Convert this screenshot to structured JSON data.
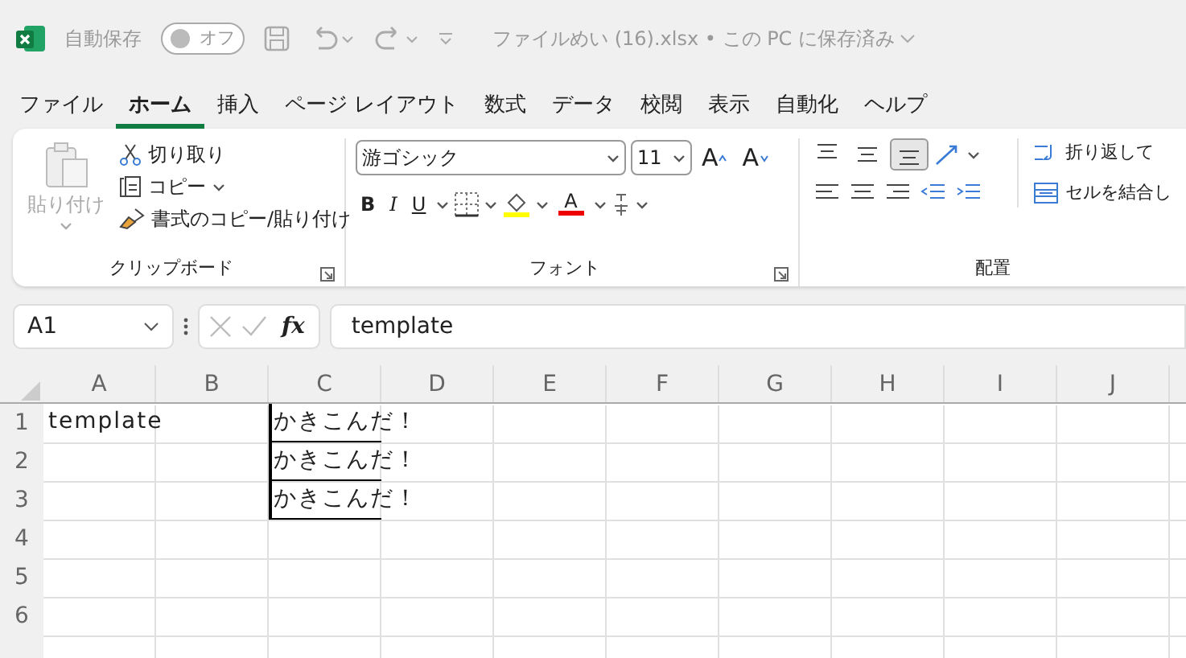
{
  "title_bar": {
    "autosave_label": "自動保存",
    "autosave_toggle": {
      "label": "オフ",
      "on": false
    },
    "file_title": "ファイルめい (16).xlsx • この PC に保存済み"
  },
  "tabs": [
    {
      "label": "ファイル",
      "selected": false
    },
    {
      "label": "ホーム",
      "selected": true
    },
    {
      "label": "挿入",
      "selected": false
    },
    {
      "label": "ページ レイアウト",
      "selected": false
    },
    {
      "label": "数式",
      "selected": false
    },
    {
      "label": "データ",
      "selected": false
    },
    {
      "label": "校閲",
      "selected": false
    },
    {
      "label": "表示",
      "selected": false
    },
    {
      "label": "自動化",
      "selected": false
    },
    {
      "label": "ヘルプ",
      "selected": false
    }
  ],
  "ribbon": {
    "clipboard": {
      "paste": {
        "label": "貼り付け",
        "disabled": true
      },
      "cut": "切り取り",
      "copy": "コピー",
      "format_painter": "書式のコピー/貼り付け",
      "group_label": "クリップボード"
    },
    "font": {
      "font_name": "游ゴシック",
      "font_size": "11",
      "grow": "A",
      "shrink": "A",
      "bold": "B",
      "italic": "I",
      "underline": "U",
      "font_color": "A",
      "group_label": "フォント"
    },
    "alignment": {
      "vertical_align": [
        {
          "selected": false
        },
        {
          "selected": false
        },
        {
          "selected": true
        }
      ],
      "wrap_text": "折り返して",
      "merge": "セルを結合し",
      "group_label": "配置"
    }
  },
  "formula_bar": {
    "name_box": "A1",
    "fx": "fx",
    "formula": "template"
  },
  "sheet": {
    "columns": [
      "A",
      "B",
      "C",
      "D",
      "E",
      "F",
      "G",
      "H",
      "I",
      "J"
    ],
    "rows": [
      {
        "label": "1",
        "cells": [
          {
            "kind": "plain",
            "text": "template"
          },
          {
            "kind": "plain"
          },
          {
            "kind": "bordered",
            "text": "かきこんだ！"
          }
        ]
      },
      {
        "label": "2",
        "cells": [
          {
            "kind": "plain"
          },
          {
            "kind": "plain"
          },
          {
            "kind": "bordered",
            "text": "かきこんだ！"
          }
        ]
      },
      {
        "label": "3",
        "cells": [
          {
            "kind": "plain"
          },
          {
            "kind": "plain"
          },
          {
            "kind": "bordered",
            "text": "かきこんだ！"
          }
        ]
      },
      {
        "label": "4",
        "cells": []
      },
      {
        "label": "5",
        "cells": []
      },
      {
        "label": "6",
        "cells": []
      }
    ]
  }
}
